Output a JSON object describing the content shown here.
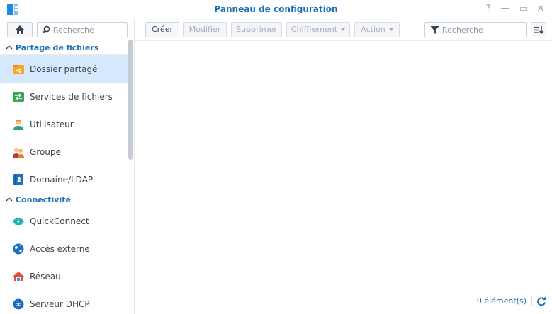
{
  "window": {
    "title": "Panneau de configuration",
    "help_glyph": "?",
    "minimize_glyph": "—",
    "maximize_glyph": "▭",
    "close_glyph": "✕"
  },
  "sidebar": {
    "search_placeholder": "Recherche",
    "sections": [
      {
        "label": "Partage de fichiers",
        "items": [
          {
            "label": "Dossier partagé",
            "icon": "shared-folder-icon",
            "active": true
          },
          {
            "label": "Services de fichiers",
            "icon": "file-services-icon"
          },
          {
            "label": "Utilisateur",
            "icon": "user-icon"
          },
          {
            "label": "Groupe",
            "icon": "group-icon"
          },
          {
            "label": "Domaine/LDAP",
            "icon": "domain-ldap-icon"
          }
        ]
      },
      {
        "label": "Connectivité",
        "items": [
          {
            "label": "QuickConnect",
            "icon": "quickconnect-icon"
          },
          {
            "label": "Accès externe",
            "icon": "external-access-icon"
          },
          {
            "label": "Réseau",
            "icon": "network-icon"
          },
          {
            "label": "Serveur DHCP",
            "icon": "dhcp-server-icon"
          }
        ]
      }
    ]
  },
  "toolbar": {
    "create": "Créer",
    "modify": "Modifier",
    "delete": "Supprimer",
    "encryption": "Chiffrement",
    "action": "Action",
    "filter_placeholder": "Recherche"
  },
  "status": {
    "count": "0 élément(s)"
  },
  "colors": {
    "accent": "#1e6fb5",
    "active_bg": "#d4e9fb"
  }
}
